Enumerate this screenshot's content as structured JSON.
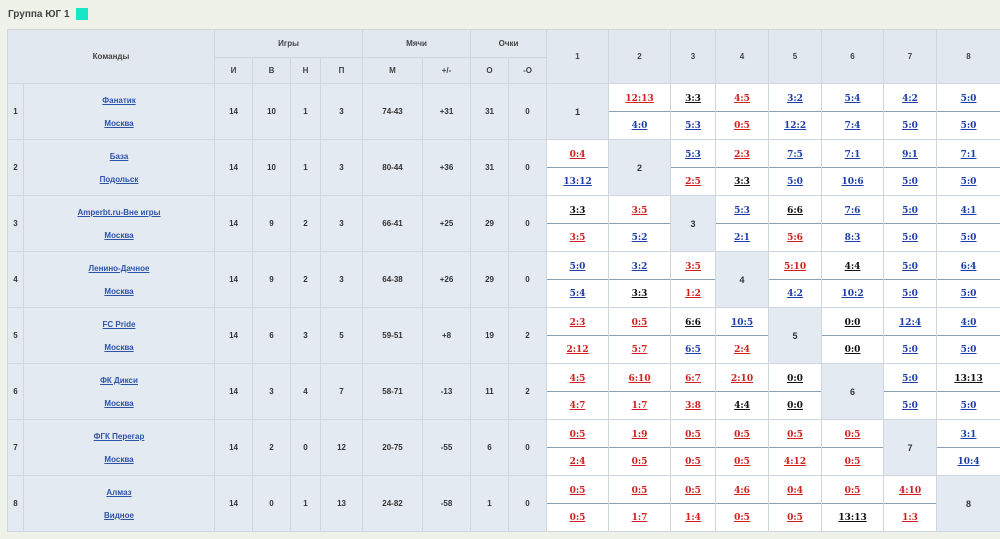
{
  "group": {
    "title": "Группа  ЮГ 1",
    "swatch_color": "#19e6c8"
  },
  "headers": {
    "teams": "Команды",
    "games": "Игры",
    "goals": "Мячи",
    "points": "Очки",
    "sub": [
      "И",
      "В",
      "Н",
      "П",
      "М",
      "+/-",
      "О",
      "-О"
    ],
    "opponents": [
      "1",
      "2",
      "3",
      "4",
      "5",
      "6",
      "7",
      "8"
    ]
  },
  "teams": [
    {
      "num": "1",
      "name": "Фанатик",
      "city": "Москва",
      "stats": [
        "14",
        "10",
        "1",
        "3",
        "74-43",
        "+31",
        "31",
        "0"
      ],
      "results": [
        null,
        [
          [
            "12:13",
            "l"
          ],
          [
            "4:0",
            "w"
          ]
        ],
        [
          [
            "3:3",
            "d"
          ],
          [
            "5:3",
            "w"
          ]
        ],
        [
          [
            "4:5",
            "l"
          ],
          [
            "0:5",
            "l"
          ]
        ],
        [
          [
            "3:2",
            "w"
          ],
          [
            "12:2",
            "w"
          ]
        ],
        [
          [
            "5:4",
            "w"
          ],
          [
            "7:4",
            "w"
          ]
        ],
        [
          [
            "4:2",
            "w"
          ],
          [
            "5:0",
            "w"
          ]
        ],
        [
          [
            "5:0",
            "w"
          ],
          [
            "5:0",
            "w"
          ]
        ]
      ]
    },
    {
      "num": "2",
      "name": "База",
      "city": "Подольск",
      "stats": [
        "14",
        "10",
        "1",
        "3",
        "80-44",
        "+36",
        "31",
        "0"
      ],
      "results": [
        [
          [
            "0:4",
            "l"
          ],
          [
            "13:12",
            "w"
          ]
        ],
        null,
        [
          [
            "5:3",
            "w"
          ],
          [
            "2:5",
            "l"
          ]
        ],
        [
          [
            "2:3",
            "l"
          ],
          [
            "3:3",
            "d"
          ]
        ],
        [
          [
            "7:5",
            "w"
          ],
          [
            "5:0",
            "w"
          ]
        ],
        [
          [
            "7:1",
            "w"
          ],
          [
            "10:6",
            "w"
          ]
        ],
        [
          [
            "9:1",
            "w"
          ],
          [
            "5:0",
            "w"
          ]
        ],
        [
          [
            "7:1",
            "w"
          ],
          [
            "5:0",
            "w"
          ]
        ]
      ]
    },
    {
      "num": "3",
      "name": "Amperbt.ru-Вне игры",
      "city": "Москва",
      "stats": [
        "14",
        "9",
        "2",
        "3",
        "66-41",
        "+25",
        "29",
        "0"
      ],
      "results": [
        [
          [
            "3:3",
            "d"
          ],
          [
            "3:5",
            "l"
          ]
        ],
        [
          [
            "3:5",
            "l"
          ],
          [
            "5:2",
            "w"
          ]
        ],
        null,
        [
          [
            "5:3",
            "w"
          ],
          [
            "2:1",
            "w"
          ]
        ],
        [
          [
            "6:6",
            "d"
          ],
          [
            "5:6",
            "l"
          ]
        ],
        [
          [
            "7:6",
            "w"
          ],
          [
            "8:3",
            "w"
          ]
        ],
        [
          [
            "5:0",
            "w"
          ],
          [
            "5:0",
            "w"
          ]
        ],
        [
          [
            "4:1",
            "w"
          ],
          [
            "5:0",
            "w"
          ]
        ]
      ]
    },
    {
      "num": "4",
      "name": "Ленино-Дачное",
      "city": "Москва",
      "stats": [
        "14",
        "9",
        "2",
        "3",
        "64-38",
        "+26",
        "29",
        "0"
      ],
      "results": [
        [
          [
            "5:0",
            "w"
          ],
          [
            "5:4",
            "w"
          ]
        ],
        [
          [
            "3:2",
            "w"
          ],
          [
            "3:3",
            "d"
          ]
        ],
        [
          [
            "3:5",
            "l"
          ],
          [
            "1:2",
            "l"
          ]
        ],
        null,
        [
          [
            "5:10",
            "l"
          ],
          [
            "4:2",
            "w"
          ]
        ],
        [
          [
            "4:4",
            "d"
          ],
          [
            "10:2",
            "w"
          ]
        ],
        [
          [
            "5:0",
            "w"
          ],
          [
            "5:0",
            "w"
          ]
        ],
        [
          [
            "6:4",
            "w"
          ],
          [
            "5:0",
            "w"
          ]
        ]
      ]
    },
    {
      "num": "5",
      "name": "FC Pride",
      "city": "Москва",
      "stats": [
        "14",
        "6",
        "3",
        "5",
        "59-51",
        "+8",
        "19",
        "2"
      ],
      "results": [
        [
          [
            "2:3",
            "l"
          ],
          [
            "2:12",
            "l"
          ]
        ],
        [
          [
            "0:5",
            "l"
          ],
          [
            "5:7",
            "l"
          ]
        ],
        [
          [
            "6:6",
            "d"
          ],
          [
            "6:5",
            "w"
          ]
        ],
        [
          [
            "10:5",
            "w"
          ],
          [
            "2:4",
            "l"
          ]
        ],
        null,
        [
          [
            "0:0",
            "d"
          ],
          [
            "0:0",
            "d"
          ]
        ],
        [
          [
            "12:4",
            "w"
          ],
          [
            "5:0",
            "w"
          ]
        ],
        [
          [
            "4:0",
            "w"
          ],
          [
            "5:0",
            "w"
          ]
        ]
      ]
    },
    {
      "num": "6",
      "name": "ФК Дикси",
      "city": "Москва",
      "stats": [
        "14",
        "3",
        "4",
        "7",
        "58-71",
        "-13",
        "11",
        "2"
      ],
      "results": [
        [
          [
            "4:5",
            "l"
          ],
          [
            "4:7",
            "l"
          ]
        ],
        [
          [
            "6:10",
            "l"
          ],
          [
            "1:7",
            "l"
          ]
        ],
        [
          [
            "6:7",
            "l"
          ],
          [
            "3:8",
            "l"
          ]
        ],
        [
          [
            "2:10",
            "l"
          ],
          [
            "4:4",
            "d"
          ]
        ],
        [
          [
            "0:0",
            "d"
          ],
          [
            "0:0",
            "d"
          ]
        ],
        null,
        [
          [
            "5:0",
            "w"
          ],
          [
            "5:0",
            "w"
          ]
        ],
        [
          [
            "13:13",
            "d"
          ],
          [
            "5:0",
            "w"
          ]
        ]
      ]
    },
    {
      "num": "7",
      "name": "ФГК Перегар",
      "city": "Москва",
      "stats": [
        "14",
        "2",
        "0",
        "12",
        "20-75",
        "-55",
        "6",
        "0"
      ],
      "results": [
        [
          [
            "0:5",
            "l"
          ],
          [
            "2:4",
            "l"
          ]
        ],
        [
          [
            "1:9",
            "l"
          ],
          [
            "0:5",
            "l"
          ]
        ],
        [
          [
            "0:5",
            "l"
          ],
          [
            "0:5",
            "l"
          ]
        ],
        [
          [
            "0:5",
            "l"
          ],
          [
            "0:5",
            "l"
          ]
        ],
        [
          [
            "0:5",
            "l"
          ],
          [
            "4:12",
            "l"
          ]
        ],
        [
          [
            "0:5",
            "l"
          ],
          [
            "0:5",
            "l"
          ]
        ],
        null,
        [
          [
            "3:1",
            "w"
          ],
          [
            "10:4",
            "w"
          ]
        ]
      ]
    },
    {
      "num": "8",
      "name": "Алмаз",
      "city": "Видное",
      "stats": [
        "14",
        "0",
        "1",
        "13",
        "24-82",
        "-58",
        "1",
        "0"
      ],
      "results": [
        [
          [
            "0:5",
            "l"
          ],
          [
            "0:5",
            "l"
          ]
        ],
        [
          [
            "0:5",
            "l"
          ],
          [
            "1:7",
            "l"
          ]
        ],
        [
          [
            "0:5",
            "l"
          ],
          [
            "1:4",
            "l"
          ]
        ],
        [
          [
            "4:6",
            "l"
          ],
          [
            "0:5",
            "l"
          ]
        ],
        [
          [
            "0:4",
            "l"
          ],
          [
            "0:5",
            "l"
          ]
        ],
        [
          [
            "0:5",
            "l"
          ],
          [
            "13:13",
            "d"
          ]
        ],
        [
          [
            "4:10",
            "l"
          ],
          [
            "1:3",
            "l"
          ]
        ],
        null
      ]
    }
  ]
}
